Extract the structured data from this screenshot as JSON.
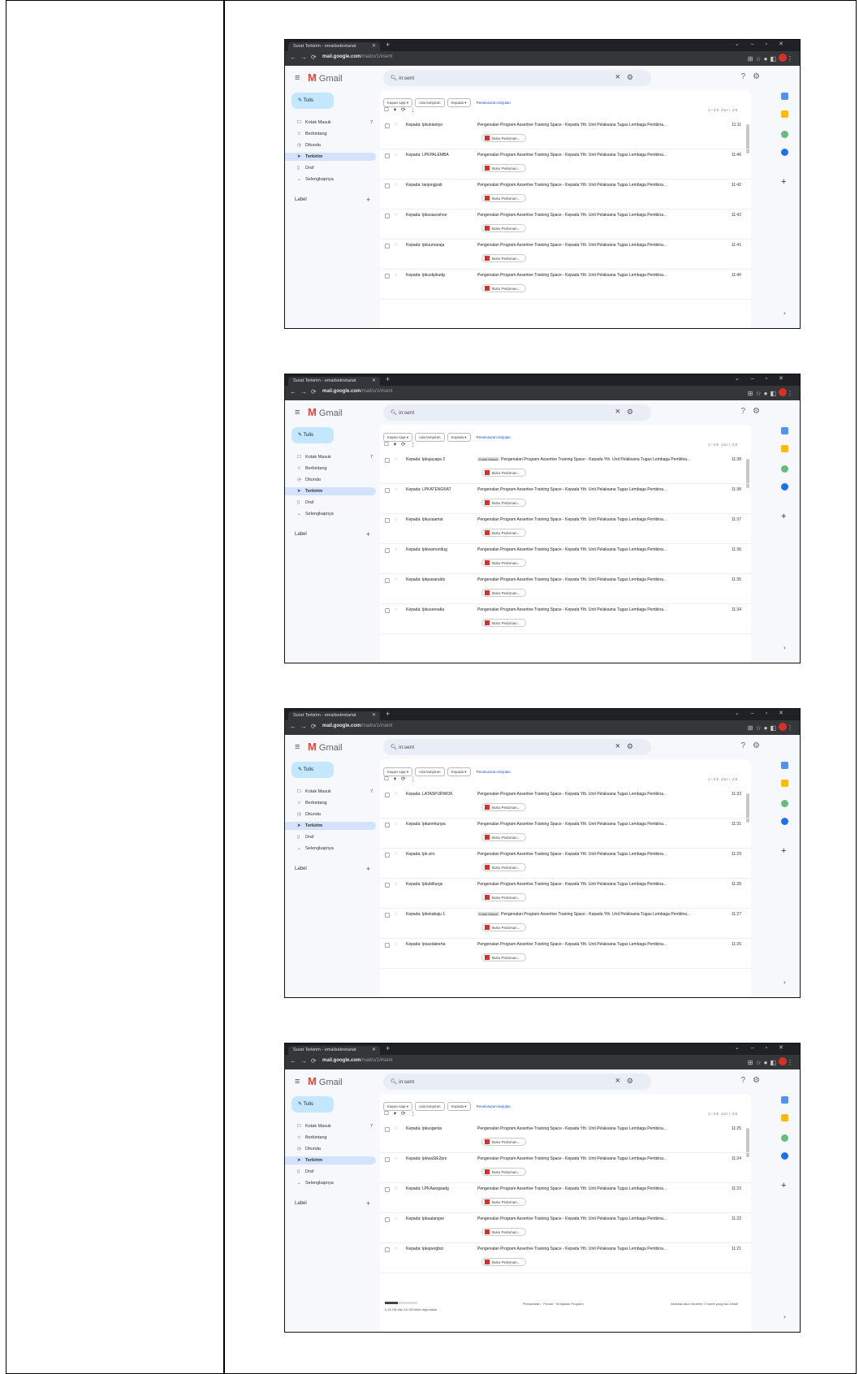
{
  "shots": [
    {
      "rows": [
        {
          "to": "Kepada: lpkukiantyo",
          "tag": "",
          "time": "11:11"
        },
        {
          "to": "Kepada: LPKPALEMBA",
          "tag": "",
          "time": "11:46"
        },
        {
          "to": "Kepada: tanjungpati",
          "tag": "",
          "time": "11:42"
        },
        {
          "to": "Kepada: lpkusasoshoe",
          "tag": "",
          "time": "11:42"
        },
        {
          "to": "Kepada: lpkuumaraja",
          "tag": "",
          "time": "11:41"
        },
        {
          "to": "Kepada: lpkuskpkudg",
          "tag": "",
          "time": "11:40"
        }
      ]
    },
    {
      "rows": [
        {
          "to": "Kepada: lpkujayapa 2",
          "tag": "Kotak Masuk",
          "time": "11:38"
        },
        {
          "to": "Kepada: LPKATENGKAT",
          "tag": "",
          "time": "11:38"
        },
        {
          "to": "Kepada: lpkusaamat",
          "tag": "",
          "time": "11:37"
        },
        {
          "to": "Kepada: lpkwamondug",
          "tag": "",
          "time": "11:36"
        },
        {
          "to": "Kepada: lpkpasaraids",
          "tag": "",
          "time": "11:35"
        },
        {
          "to": "Kepada: lpkusereatla",
          "tag": "",
          "time": "11:34"
        }
      ]
    },
    {
      "rows": [
        {
          "to": "Kepada: LATASPURWOK",
          "tag": "",
          "time": "11:33"
        },
        {
          "to": "Kepada: lpkanmtunpa",
          "tag": "",
          "time": "11:31"
        },
        {
          "to": "Kepada: lpk.cirs",
          "tag": "",
          "time": "11:29"
        },
        {
          "to": "Kepada: lpkubliturgs",
          "tag": "",
          "time": "11:28"
        },
        {
          "to": "Kepada: lpkekabaju 1",
          "tag": "Kotak Masuk",
          "time": "11:27"
        },
        {
          "to": "Kepada: lpsasdakerta",
          "tag": "",
          "time": "11:26"
        }
      ]
    },
    {
      "rows": [
        {
          "to": "Kepada: lpkusgenta",
          "tag": "",
          "time": "11:25"
        },
        {
          "to": "Kepada: lpkwaSiE2prs",
          "tag": "",
          "time": "11:24"
        },
        {
          "to": "Kepada: LPKAwogsadg",
          "tag": "",
          "time": "11:23"
        },
        {
          "to": "Kepada: lpkaatangse",
          "tag": "",
          "time": "11:22"
        },
        {
          "to": "Kepada: lpkapergbst",
          "tag": "",
          "time": "11:21"
        }
      ],
      "footer": {
        "storage": "0,18 GB dari 15 GB telah digunakan",
        "middle": "Persyaratan · Privasi · Kebijakan Program",
        "right": "Aktivitas akun terakhir: 0 menit yang lalu Detail"
      }
    }
  ],
  "browser": {
    "tab_title": "Surat Terkirim - emailsekretariat",
    "url": "mail.google.com",
    "url_path": "/mail/u/1/#sent"
  },
  "gmail": {
    "logo": "Gmail",
    "search": "in:sent",
    "compose": "Tulis",
    "sidebar": [
      {
        "icon": "inbox-icon",
        "label": "Kotak Masuk",
        "count": "7"
      },
      {
        "icon": "star-icon",
        "label": "Berbintang",
        "count": ""
      },
      {
        "icon": "clock-icon",
        "label": "Ditunda",
        "count": ""
      },
      {
        "icon": "send-icon",
        "label": "Terkirim",
        "count": ""
      },
      {
        "icon": "draft-icon",
        "label": "Draf",
        "count": ""
      },
      {
        "icon": "chevron-down-icon",
        "label": "Selengkapnya",
        "count": ""
      }
    ],
    "label_heading": "Label",
    "chips": [
      "Kapan saja ▾",
      "Ada lampiran",
      "Kepada ▾"
    ],
    "advanced_link": "Penelusuran lanjutan",
    "pager": "1–28 dari 28",
    "subject": "Pengenalan Program Assertive Training Space - Kepada Yth. Unit Pelaksana Tugas Lembaga Pembina...",
    "attachment": "Buku Pedoman..."
  },
  "colors": {
    "accent": "#0b57d0",
    "selected": "#d3e3fd",
    "compose": "#c2e7ff",
    "chrome": "#202124"
  }
}
